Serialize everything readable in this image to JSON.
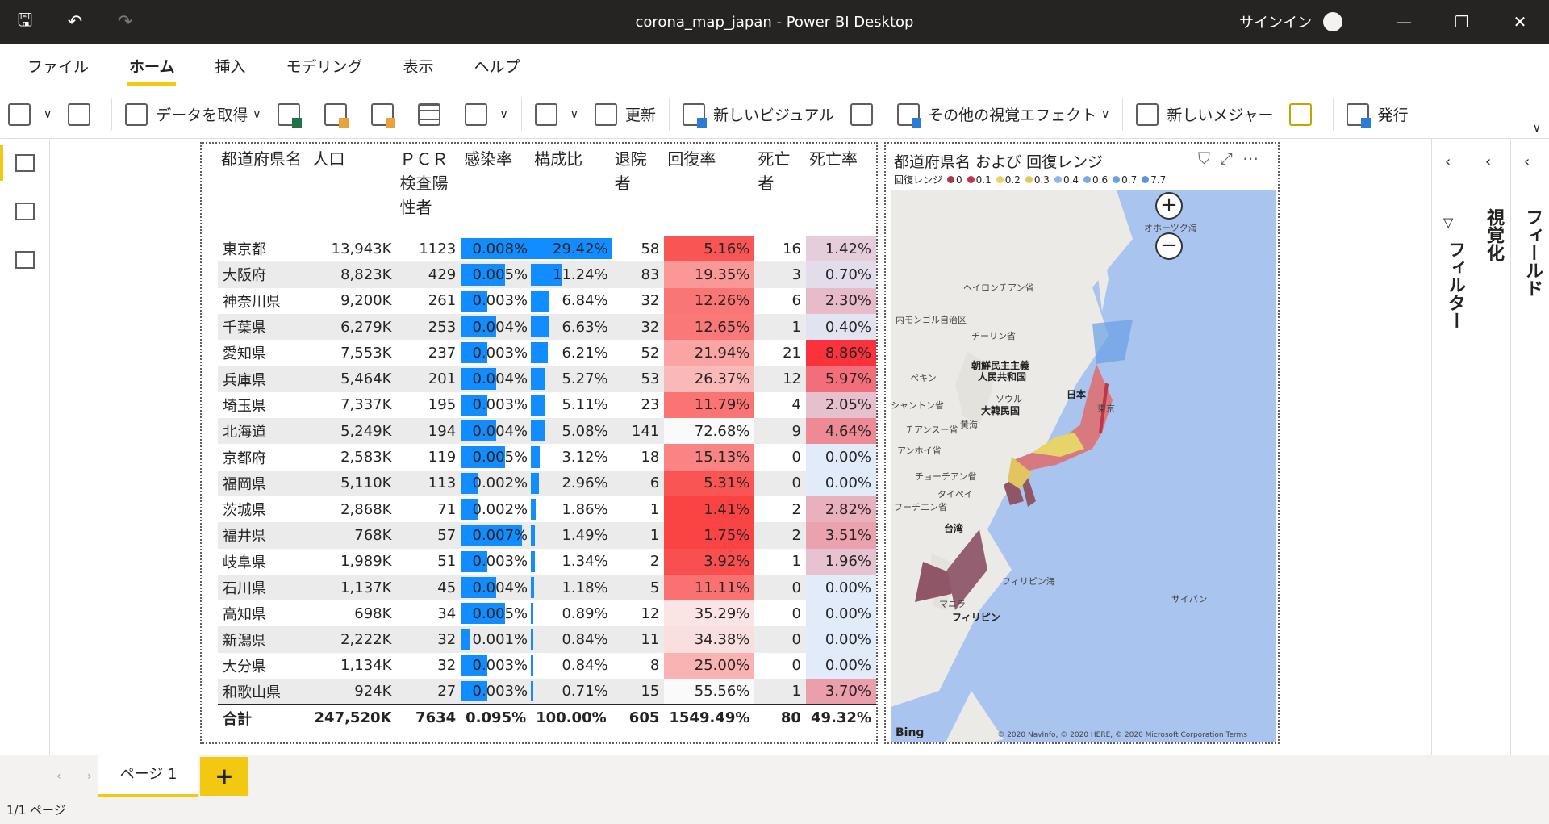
{
  "window": {
    "title": "corona_map_japan - Power BI Desktop",
    "signin": "サインイン"
  },
  "menu": [
    "ファイル",
    "ホーム",
    "挿入",
    "モデリング",
    "表示",
    "ヘルプ"
  ],
  "ribbon": {
    "get_data": "データを取得",
    "refresh": "更新",
    "new_visual": "新しいビジュアル",
    "more_visuals": "その他の視覚エフェクト",
    "new_measure": "新しいメジャー",
    "publish": "発行"
  },
  "table": {
    "headers": [
      "都道府県名",
      "人口",
      "ＰＣＲ検査陽性者",
      "感染率",
      "構成比",
      "退院者",
      "回復率",
      "死亡者",
      "死亡率"
    ],
    "rows": [
      [
        "東京都",
        "13,943K",
        "1123",
        "0.008%",
        "29.42%",
        "58",
        "5.16%",
        "16",
        "1.42%"
      ],
      [
        "大阪府",
        "8,823K",
        "429",
        "0.005%",
        "11.24%",
        "83",
        "19.35%",
        "3",
        "0.70%"
      ],
      [
        "神奈川県",
        "9,200K",
        "261",
        "0.003%",
        "6.84%",
        "32",
        "12.26%",
        "6",
        "2.30%"
      ],
      [
        "千葉県",
        "6,279K",
        "253",
        "0.004%",
        "6.63%",
        "32",
        "12.65%",
        "1",
        "0.40%"
      ],
      [
        "愛知県",
        "7,553K",
        "237",
        "0.003%",
        "6.21%",
        "52",
        "21.94%",
        "21",
        "8.86%"
      ],
      [
        "兵庫県",
        "5,464K",
        "201",
        "0.004%",
        "5.27%",
        "53",
        "26.37%",
        "12",
        "5.97%"
      ],
      [
        "埼玉県",
        "7,337K",
        "195",
        "0.003%",
        "5.11%",
        "23",
        "11.79%",
        "4",
        "2.05%"
      ],
      [
        "北海道",
        "5,249K",
        "194",
        "0.004%",
        "5.08%",
        "141",
        "72.68%",
        "9",
        "4.64%"
      ],
      [
        "京都府",
        "2,583K",
        "119",
        "0.005%",
        "3.12%",
        "18",
        "15.13%",
        "0",
        "0.00%"
      ],
      [
        "福岡県",
        "5,110K",
        "113",
        "0.002%",
        "2.96%",
        "6",
        "5.31%",
        "0",
        "0.00%"
      ],
      [
        "茨城県",
        "2,868K",
        "71",
        "0.002%",
        "1.86%",
        "1",
        "1.41%",
        "2",
        "2.82%"
      ],
      [
        "福井県",
        "768K",
        "57",
        "0.007%",
        "1.49%",
        "1",
        "1.75%",
        "2",
        "3.51%"
      ],
      [
        "岐阜県",
        "1,989K",
        "51",
        "0.003%",
        "1.34%",
        "2",
        "3.92%",
        "1",
        "1.96%"
      ],
      [
        "石川県",
        "1,137K",
        "45",
        "0.004%",
        "1.18%",
        "5",
        "11.11%",
        "0",
        "0.00%"
      ],
      [
        "高知県",
        "698K",
        "34",
        "0.005%",
        "0.89%",
        "12",
        "35.29%",
        "0",
        "0.00%"
      ],
      [
        "新潟県",
        "2,222K",
        "32",
        "0.001%",
        "0.84%",
        "11",
        "34.38%",
        "0",
        "0.00%"
      ],
      [
        "大分県",
        "1,134K",
        "32",
        "0.003%",
        "0.84%",
        "8",
        "25.00%",
        "0",
        "0.00%"
      ],
      [
        "和歌山県",
        "924K",
        "27",
        "0.003%",
        "0.71%",
        "15",
        "55.56%",
        "1",
        "3.70%"
      ]
    ],
    "total": [
      "合計",
      "247,520K",
      "7634",
      "0.095%",
      "100.00%",
      "605",
      "1549.49%",
      "80",
      "49.32%"
    ]
  },
  "map": {
    "title": "都道府県名 および 回復レンジ",
    "legend_title": "回復レンジ",
    "legend": [
      [
        "0",
        "#a8384a"
      ],
      [
        "0.1",
        "#c0354a"
      ],
      [
        "0.2",
        "#e6d46b"
      ],
      [
        "0.3",
        "#e0c560"
      ],
      [
        "0.4",
        "#8fb4ea"
      ],
      [
        "0.6",
        "#7ba8e8"
      ],
      [
        "0.7",
        "#6aa0e6"
      ],
      [
        "7.7",
        "#5b95e0"
      ]
    ],
    "labels": {
      "okhotsk": "オホーツク海",
      "heilongjiang": "ヘイロンチアン省",
      "inner_mongolia": "内モンゴル自治区",
      "jilin": "チーリン省",
      "north_korea_1": "朝鮮民主主義",
      "north_korea_2": "人民共和国",
      "beijing": "ペキン",
      "seoul": "ソウル",
      "south_korea": "大韓民国",
      "japan": "日本",
      "tokyo": "東京",
      "yellow_sea": "黄海",
      "shandong": "シャントン省",
      "jiangsu": "チアンスー省",
      "anhui": "アンホイ省",
      "zhejiang": "チョーチアン省",
      "fujian": "フーチエン省",
      "taipei": "タイペイ",
      "taiwan": "台湾",
      "philippine_sea": "フィリピン海",
      "manila": "マニラ",
      "philippines": "フィリピン",
      "saipan": "サイパン",
      "copyright": "© 2020 NavInfo, © 2020 HERE, © 2020 Microsoft Corporation  Terms",
      "bing": "Bing"
    }
  },
  "panes": {
    "filter": "フィルター",
    "visualize": "視覚化",
    "fields": "フィールド"
  },
  "pages": {
    "tab": "ページ 1",
    "add": "+",
    "status": "1/1 ページ"
  }
}
